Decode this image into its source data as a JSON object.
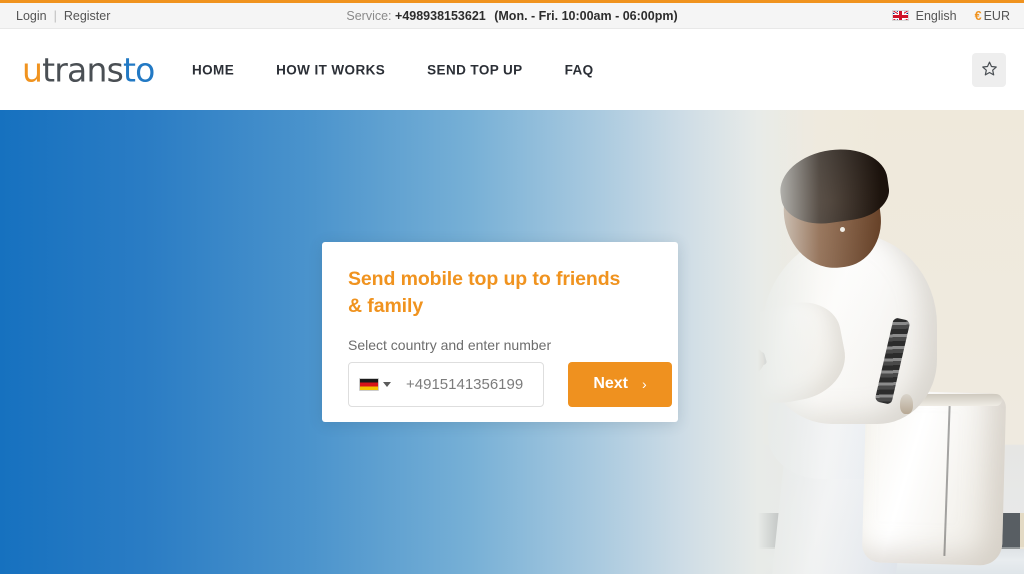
{
  "utility_bar": {
    "login_label": "Login",
    "separator": "|",
    "register_label": "Register",
    "service_label": "Service:",
    "service_phone": "+498938153621",
    "service_hours": "(Mon. - Fri. 10:00am - 06:00pm)",
    "language": "English",
    "language_flag": "uk-flag-icon",
    "currency_symbol": "€",
    "currency": "EUR"
  },
  "header": {
    "logo": {
      "part1": "u",
      "part2": "trans",
      "part3": "to"
    },
    "nav": [
      {
        "label": "HOME"
      },
      {
        "label": "HOW IT WORKS"
      },
      {
        "label": "SEND TOP UP"
      },
      {
        "label": "FAQ"
      }
    ],
    "favorite_icon": "star-icon"
  },
  "hero": {
    "card": {
      "title": "Send mobile top up to friends & family",
      "subtitle": "Select country and enter number",
      "country_flag": "germany-flag-icon",
      "phone_value": "+4915141356199",
      "phone_placeholder": "+4915141356199",
      "next_label": "Next",
      "next_chevron": "›"
    }
  },
  "colors": {
    "accent_orange": "#f0931f",
    "logo_blue": "#2279c4",
    "logo_gray": "#4a4f54",
    "hero_blue": "#1671bf",
    "utility_bg": "#f5f5f5"
  }
}
